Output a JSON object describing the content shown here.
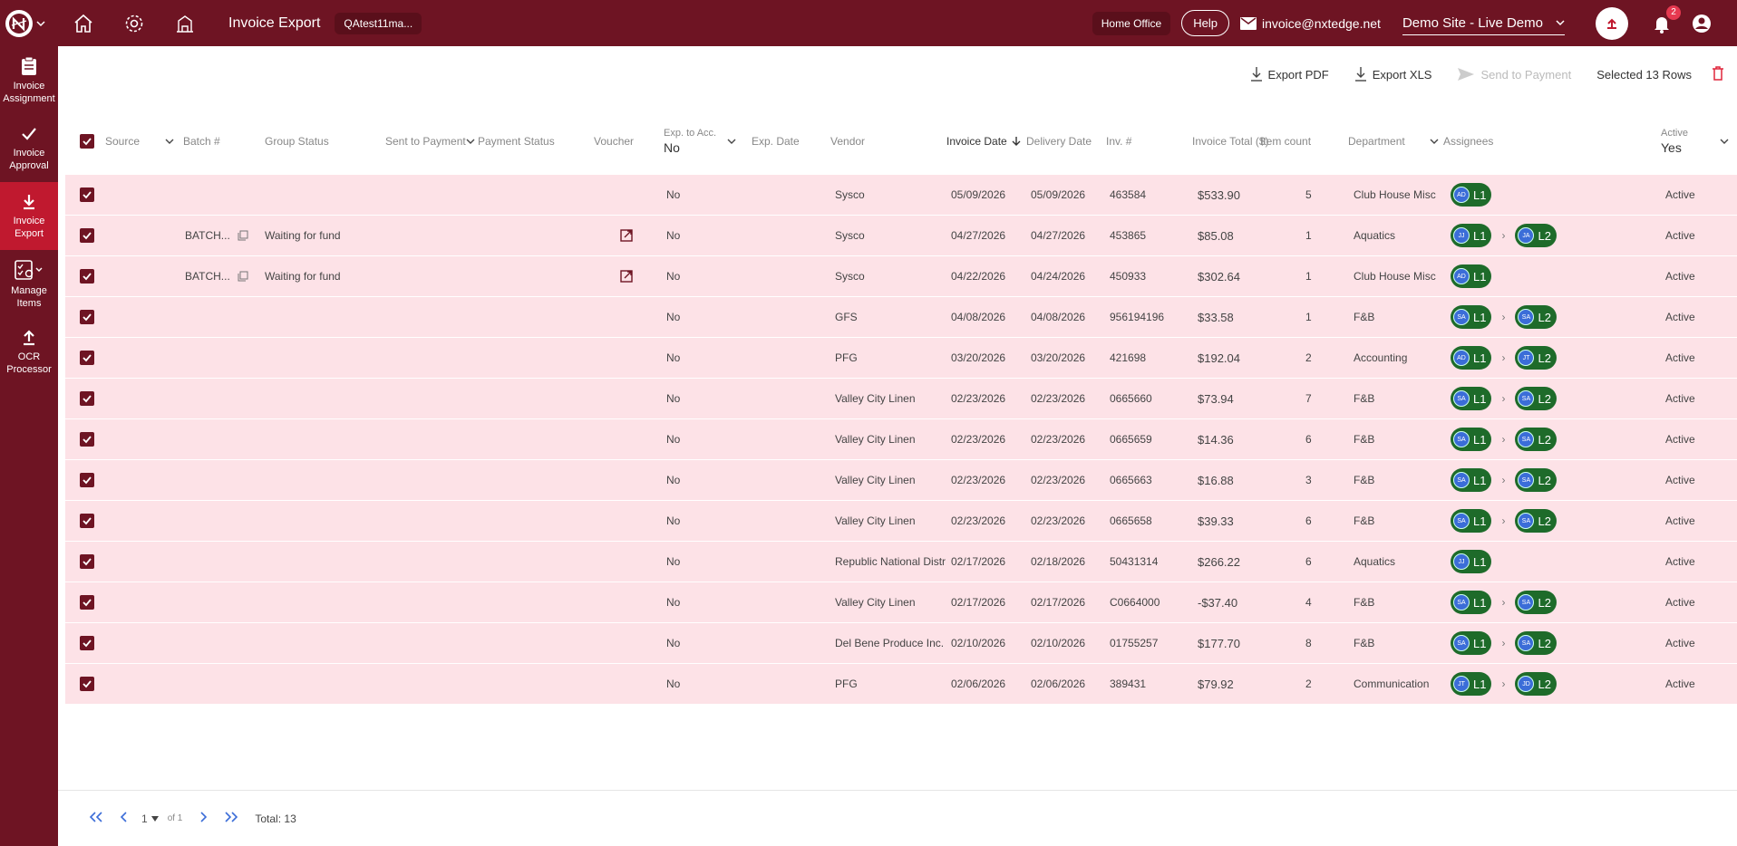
{
  "header": {
    "title": "Invoice Export",
    "user_chip": "QAtest11ma...",
    "home_office": "Home Office",
    "help": "Help",
    "email": "invoice@nxtedge.net",
    "site": "Demo Site - Live Demo",
    "notifications_count": "2"
  },
  "sidebar": {
    "items": [
      {
        "label": "Invoice Assignment"
      },
      {
        "label": "Invoice Approval"
      },
      {
        "label": "Invoice Export"
      },
      {
        "label": "Manage Items"
      },
      {
        "label": "OCR Processor"
      }
    ]
  },
  "toolbar": {
    "export_pdf": "Export PDF",
    "export_xls": "Export XLS",
    "send_to_payment": "Send to Payment",
    "selected": "Selected 13 Rows"
  },
  "columns": {
    "source": "Source",
    "batch": "Batch #",
    "group_status": "Group Status",
    "sent_to_payment": "Sent to Payment",
    "payment_status": "Payment Status",
    "voucher": "Voucher",
    "exp_to_acc_label": "Exp. to Acc.",
    "exp_to_acc_value": "No",
    "exp_date": "Exp. Date",
    "vendor": "Vendor",
    "invoice_date": "Invoice Date",
    "delivery_date": "Delivery Date",
    "inv_no": "Inv. #",
    "invoice_total": "Invoice Total ($)",
    "item_count": "Item count",
    "department": "Department",
    "assignees": "Assignees",
    "active_label": "Active",
    "active_value": "Yes"
  },
  "rows": [
    {
      "batch": "",
      "group_status": "",
      "voucher": false,
      "exp": "No",
      "vendor": "Sysco",
      "inv_date": "05/09/2026",
      "del_date": "05/09/2026",
      "inv": "463584",
      "total": "$533.90",
      "count": "5",
      "dept": "Club House Misc",
      "a1": "AD",
      "a2": "",
      "active": "Active"
    },
    {
      "batch": "BATCH...",
      "group_status": "Waiting for fund",
      "voucher": true,
      "exp": "No",
      "vendor": "Sysco",
      "inv_date": "04/27/2026",
      "del_date": "04/27/2026",
      "inv": "453865",
      "total": "$85.08",
      "count": "1",
      "dept": "Aquatics",
      "a1": "JJ",
      "a2": "JA",
      "active": "Active"
    },
    {
      "batch": "BATCH...",
      "group_status": "Waiting for fund",
      "voucher": true,
      "exp": "No",
      "vendor": "Sysco",
      "inv_date": "04/22/2026",
      "del_date": "04/24/2026",
      "inv": "450933",
      "total": "$302.64",
      "count": "1",
      "dept": "Club House Misc",
      "a1": "AD",
      "a2": "",
      "active": "Active"
    },
    {
      "batch": "",
      "group_status": "",
      "voucher": false,
      "exp": "No",
      "vendor": "GFS",
      "inv_date": "04/08/2026",
      "del_date": "04/08/2026",
      "inv": "956194196",
      "total": "$33.58",
      "count": "1",
      "dept": "F&B",
      "a1": "SA",
      "a2": "SA",
      "active": "Active"
    },
    {
      "batch": "",
      "group_status": "",
      "voucher": false,
      "exp": "No",
      "vendor": "PFG",
      "inv_date": "03/20/2026",
      "del_date": "03/20/2026",
      "inv": "421698",
      "total": "$192.04",
      "count": "2",
      "dept": "Accounting",
      "a1": "AD",
      "a2": "JT",
      "active": "Active"
    },
    {
      "batch": "",
      "group_status": "",
      "voucher": false,
      "exp": "No",
      "vendor": "Valley City Linen",
      "inv_date": "02/23/2026",
      "del_date": "02/23/2026",
      "inv": "0665660",
      "total": "$73.94",
      "count": "7",
      "dept": "F&B",
      "a1": "SA",
      "a2": "SA",
      "active": "Active"
    },
    {
      "batch": "",
      "group_status": "",
      "voucher": false,
      "exp": "No",
      "vendor": "Valley City Linen",
      "inv_date": "02/23/2026",
      "del_date": "02/23/2026",
      "inv": "0665659",
      "total": "$14.36",
      "count": "6",
      "dept": "F&B",
      "a1": "SA",
      "a2": "SA",
      "active": "Active"
    },
    {
      "batch": "",
      "group_status": "",
      "voucher": false,
      "exp": "No",
      "vendor": "Valley City Linen",
      "inv_date": "02/23/2026",
      "del_date": "02/23/2026",
      "inv": "0665663",
      "total": "$16.88",
      "count": "3",
      "dept": "F&B",
      "a1": "SA",
      "a2": "SA",
      "active": "Active"
    },
    {
      "batch": "",
      "group_status": "",
      "voucher": false,
      "exp": "No",
      "vendor": "Valley City Linen",
      "inv_date": "02/23/2026",
      "del_date": "02/23/2026",
      "inv": "0665658",
      "total": "$39.33",
      "count": "6",
      "dept": "F&B",
      "a1": "SA",
      "a2": "SA",
      "active": "Active"
    },
    {
      "batch": "",
      "group_status": "",
      "voucher": false,
      "exp": "No",
      "vendor": "Republic National Distr",
      "inv_date": "02/17/2026",
      "del_date": "02/18/2026",
      "inv": "50431314",
      "total": "$266.22",
      "count": "6",
      "dept": "Aquatics",
      "a1": "JJ",
      "a2": "",
      "active": "Active"
    },
    {
      "batch": "",
      "group_status": "",
      "voucher": false,
      "exp": "No",
      "vendor": "Valley City Linen",
      "inv_date": "02/17/2026",
      "del_date": "02/17/2026",
      "inv": "C0664000",
      "total": "-$37.40",
      "count": "4",
      "dept": "F&B",
      "a1": "SA",
      "a2": "SA",
      "active": "Active"
    },
    {
      "batch": "",
      "group_status": "",
      "voucher": false,
      "exp": "No",
      "vendor": "Del Bene Produce Inc.",
      "inv_date": "02/10/2026",
      "del_date": "02/10/2026",
      "inv": "01755257",
      "total": "$177.70",
      "count": "8",
      "dept": "F&B",
      "a1": "SA",
      "a2": "SA",
      "active": "Active"
    },
    {
      "batch": "",
      "group_status": "",
      "voucher": false,
      "exp": "No",
      "vendor": "PFG",
      "inv_date": "02/06/2026",
      "del_date": "02/06/2026",
      "inv": "389431",
      "total": "$79.92",
      "count": "2",
      "dept": "Communication",
      "a1": "JT",
      "a2": "JD",
      "active": "Active"
    }
  ],
  "pill_labels": {
    "l1": "L1",
    "l2": "L2"
  },
  "footer": {
    "page": "1",
    "of": "of 1",
    "total": "Total: 13"
  },
  "colors": {
    "brand": "#6e1423",
    "active_nav": "#c0192f",
    "row_bg": "#fde2e7",
    "pill": "#1e6b2a",
    "link": "#3b6dd8"
  }
}
